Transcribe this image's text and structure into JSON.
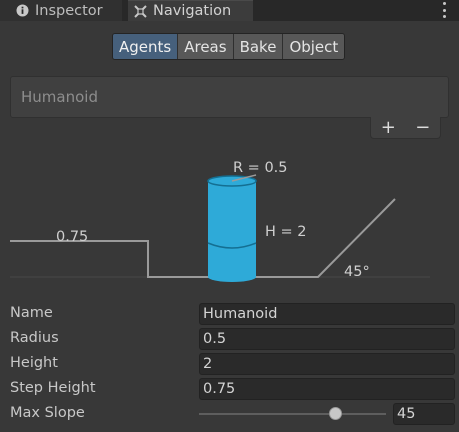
{
  "tabs": [
    {
      "label": "Inspector",
      "icon": "info-icon"
    },
    {
      "label": "Navigation",
      "icon": "navigation-icon"
    }
  ],
  "toolbar": {
    "buttons": [
      "Agents",
      "Areas",
      "Bake",
      "Object"
    ],
    "active": "Agents"
  },
  "agent_list": {
    "items": [
      "Humanoid"
    ],
    "add_label": "+",
    "remove_label": "−"
  },
  "diagram": {
    "radius_label": "R = 0.5",
    "height_label": "H = 2",
    "step_label": "0.75",
    "slope_label": "45°",
    "agent_color": "#2eaad8"
  },
  "properties": {
    "name": {
      "label": "Name",
      "value": "Humanoid"
    },
    "radius": {
      "label": "Radius",
      "value": "0.5"
    },
    "height": {
      "label": "Height",
      "value": "2"
    },
    "step_height": {
      "label": "Step Height",
      "value": "0.75"
    },
    "max_slope": {
      "label": "Max Slope",
      "value": "45",
      "slider_fraction": 0.73
    }
  }
}
